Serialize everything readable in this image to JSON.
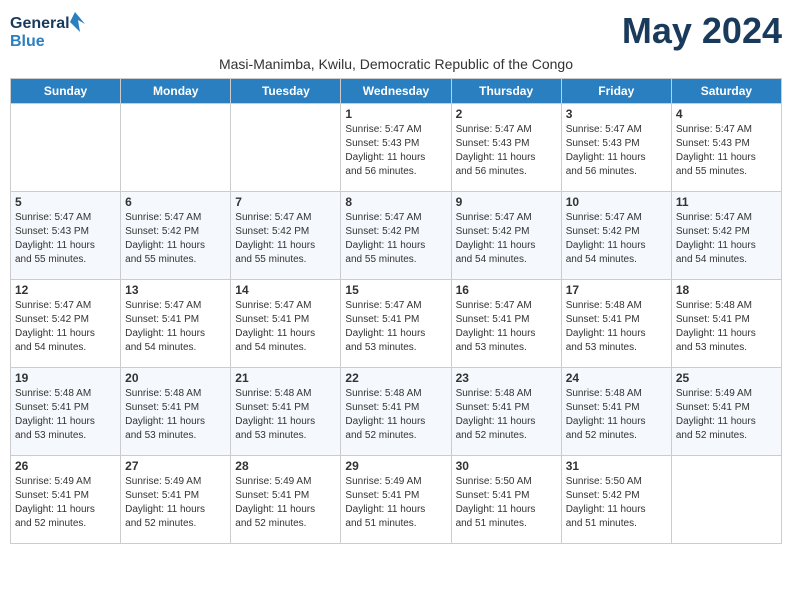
{
  "header": {
    "logo_general": "General",
    "logo_blue": "Blue",
    "month_title": "May 2024",
    "location": "Masi-Manimba, Kwilu, Democratic Republic of the Congo"
  },
  "weekdays": [
    "Sunday",
    "Monday",
    "Tuesday",
    "Wednesday",
    "Thursday",
    "Friday",
    "Saturday"
  ],
  "weeks": [
    {
      "days": [
        {
          "num": "",
          "info": ""
        },
        {
          "num": "",
          "info": ""
        },
        {
          "num": "",
          "info": ""
        },
        {
          "num": "1",
          "info": "Sunrise: 5:47 AM\nSunset: 5:43 PM\nDaylight: 11 hours\nand 56 minutes."
        },
        {
          "num": "2",
          "info": "Sunrise: 5:47 AM\nSunset: 5:43 PM\nDaylight: 11 hours\nand 56 minutes."
        },
        {
          "num": "3",
          "info": "Sunrise: 5:47 AM\nSunset: 5:43 PM\nDaylight: 11 hours\nand 56 minutes."
        },
        {
          "num": "4",
          "info": "Sunrise: 5:47 AM\nSunset: 5:43 PM\nDaylight: 11 hours\nand 55 minutes."
        }
      ]
    },
    {
      "days": [
        {
          "num": "5",
          "info": "Sunrise: 5:47 AM\nSunset: 5:43 PM\nDaylight: 11 hours\nand 55 minutes."
        },
        {
          "num": "6",
          "info": "Sunrise: 5:47 AM\nSunset: 5:42 PM\nDaylight: 11 hours\nand 55 minutes."
        },
        {
          "num": "7",
          "info": "Sunrise: 5:47 AM\nSunset: 5:42 PM\nDaylight: 11 hours\nand 55 minutes."
        },
        {
          "num": "8",
          "info": "Sunrise: 5:47 AM\nSunset: 5:42 PM\nDaylight: 11 hours\nand 55 minutes."
        },
        {
          "num": "9",
          "info": "Sunrise: 5:47 AM\nSunset: 5:42 PM\nDaylight: 11 hours\nand 54 minutes."
        },
        {
          "num": "10",
          "info": "Sunrise: 5:47 AM\nSunset: 5:42 PM\nDaylight: 11 hours\nand 54 minutes."
        },
        {
          "num": "11",
          "info": "Sunrise: 5:47 AM\nSunset: 5:42 PM\nDaylight: 11 hours\nand 54 minutes."
        }
      ]
    },
    {
      "days": [
        {
          "num": "12",
          "info": "Sunrise: 5:47 AM\nSunset: 5:42 PM\nDaylight: 11 hours\nand 54 minutes."
        },
        {
          "num": "13",
          "info": "Sunrise: 5:47 AM\nSunset: 5:41 PM\nDaylight: 11 hours\nand 54 minutes."
        },
        {
          "num": "14",
          "info": "Sunrise: 5:47 AM\nSunset: 5:41 PM\nDaylight: 11 hours\nand 54 minutes."
        },
        {
          "num": "15",
          "info": "Sunrise: 5:47 AM\nSunset: 5:41 PM\nDaylight: 11 hours\nand 53 minutes."
        },
        {
          "num": "16",
          "info": "Sunrise: 5:47 AM\nSunset: 5:41 PM\nDaylight: 11 hours\nand 53 minutes."
        },
        {
          "num": "17",
          "info": "Sunrise: 5:48 AM\nSunset: 5:41 PM\nDaylight: 11 hours\nand 53 minutes."
        },
        {
          "num": "18",
          "info": "Sunrise: 5:48 AM\nSunset: 5:41 PM\nDaylight: 11 hours\nand 53 minutes."
        }
      ]
    },
    {
      "days": [
        {
          "num": "19",
          "info": "Sunrise: 5:48 AM\nSunset: 5:41 PM\nDaylight: 11 hours\nand 53 minutes."
        },
        {
          "num": "20",
          "info": "Sunrise: 5:48 AM\nSunset: 5:41 PM\nDaylight: 11 hours\nand 53 minutes."
        },
        {
          "num": "21",
          "info": "Sunrise: 5:48 AM\nSunset: 5:41 PM\nDaylight: 11 hours\nand 53 minutes."
        },
        {
          "num": "22",
          "info": "Sunrise: 5:48 AM\nSunset: 5:41 PM\nDaylight: 11 hours\nand 52 minutes."
        },
        {
          "num": "23",
          "info": "Sunrise: 5:48 AM\nSunset: 5:41 PM\nDaylight: 11 hours\nand 52 minutes."
        },
        {
          "num": "24",
          "info": "Sunrise: 5:48 AM\nSunset: 5:41 PM\nDaylight: 11 hours\nand 52 minutes."
        },
        {
          "num": "25",
          "info": "Sunrise: 5:49 AM\nSunset: 5:41 PM\nDaylight: 11 hours\nand 52 minutes."
        }
      ]
    },
    {
      "days": [
        {
          "num": "26",
          "info": "Sunrise: 5:49 AM\nSunset: 5:41 PM\nDaylight: 11 hours\nand 52 minutes."
        },
        {
          "num": "27",
          "info": "Sunrise: 5:49 AM\nSunset: 5:41 PM\nDaylight: 11 hours\nand 52 minutes."
        },
        {
          "num": "28",
          "info": "Sunrise: 5:49 AM\nSunset: 5:41 PM\nDaylight: 11 hours\nand 52 minutes."
        },
        {
          "num": "29",
          "info": "Sunrise: 5:49 AM\nSunset: 5:41 PM\nDaylight: 11 hours\nand 51 minutes."
        },
        {
          "num": "30",
          "info": "Sunrise: 5:50 AM\nSunset: 5:41 PM\nDaylight: 11 hours\nand 51 minutes."
        },
        {
          "num": "31",
          "info": "Sunrise: 5:50 AM\nSunset: 5:42 PM\nDaylight: 11 hours\nand 51 minutes."
        },
        {
          "num": "",
          "info": ""
        }
      ]
    }
  ]
}
